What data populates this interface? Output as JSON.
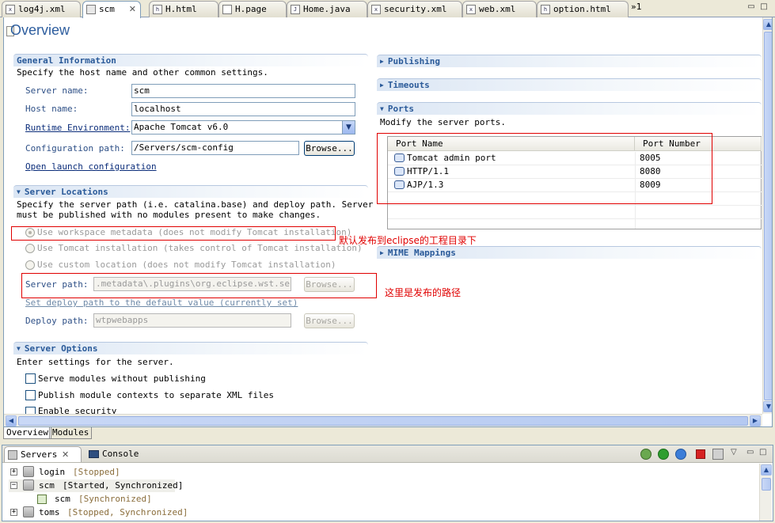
{
  "editor_tabs": [
    {
      "label": "log4j.xml",
      "icon": "xml-file-icon"
    },
    {
      "label": "scm",
      "icon": "server-icon",
      "active": true
    },
    {
      "label": "H.html",
      "icon": "html-file-icon"
    },
    {
      "label": "H.page",
      "icon": "page-file-icon"
    },
    {
      "label": "Home.java",
      "icon": "java-file-icon"
    },
    {
      "label": "security.xml",
      "icon": "xml-file-icon"
    },
    {
      "label": "web.xml",
      "icon": "xml-file-icon"
    },
    {
      "label": "option.html",
      "icon": "html-file-icon"
    }
  ],
  "tab_overflow": "»1",
  "overview": {
    "title": "Overview",
    "general": {
      "heading": "General Information",
      "desc": "Specify the host name and other common settings.",
      "server_name_label": "Server name:",
      "server_name": "scm",
      "host_name_label": "Host name:",
      "host_name": "localhost",
      "runtime_label": "Runtime Environment:",
      "runtime_value": "Apache Tomcat v6.0",
      "config_path_label": "Configuration path:",
      "config_path": "/Servers/scm-config",
      "browse": "Browse...",
      "open_launch": "Open launch configuration"
    },
    "locations": {
      "heading": "Server Locations",
      "desc_line1": "Specify the server path (i.e. catalina.base) and deploy path. Server",
      "desc_line2": "must be published with no modules present to make changes.",
      "radio_workspace": "Use workspace metadata (does not modify Tomcat installation)",
      "radio_tomcat": "Use Tomcat installation (takes control of Tomcat installation)",
      "radio_custom": "Use custom location (does not modify Tomcat installation)",
      "server_path_label": "Server path:",
      "server_path": ".metadata\\.plugins\\org.eclipse.wst.server",
      "set_deploy": "Set deploy path to the default value (currently set)",
      "deploy_path_label": "Deploy path:",
      "deploy_path": "wtpwebapps",
      "browse": "Browse..."
    },
    "options": {
      "heading": "Server Options",
      "desc": "Enter settings for the server.",
      "cb1": "Serve modules without publishing",
      "cb2": "Publish module contexts to separate XML files",
      "cb3": "Enable security"
    },
    "publishing": {
      "heading": "Publishing"
    },
    "timeouts": {
      "heading": "Timeouts"
    },
    "ports": {
      "heading": "Ports",
      "desc": "Modify the server ports.",
      "col_name": "Port Name",
      "col_number": "Port Number",
      "rows": [
        {
          "name": "Tomcat admin port",
          "number": "8005"
        },
        {
          "name": "HTTP/1.1",
          "number": "8080"
        },
        {
          "name": "AJP/1.3",
          "number": "8009"
        }
      ]
    },
    "mime": {
      "heading": "MIME Mappings"
    }
  },
  "annotations": {
    "default_publish": "默认发布到eclipse的工程目录下",
    "publish_path": "这里是发布的路径"
  },
  "editor_bottom_tabs": [
    "Overview",
    "Modules"
  ],
  "servers_view": {
    "tab_servers": "Servers",
    "tab_console": "Console",
    "tree": [
      {
        "name": "login",
        "status": "[Stopped]"
      },
      {
        "name": "scm",
        "status": "[Started, Synchronized]"
      },
      {
        "name": "scm",
        "status": "[Synchronized]"
      },
      {
        "name": "toms",
        "status": "[Stopped, Synchronized]"
      }
    ]
  },
  "colors": {
    "accent": "#2d5d9e",
    "annotation": "#e00000"
  }
}
